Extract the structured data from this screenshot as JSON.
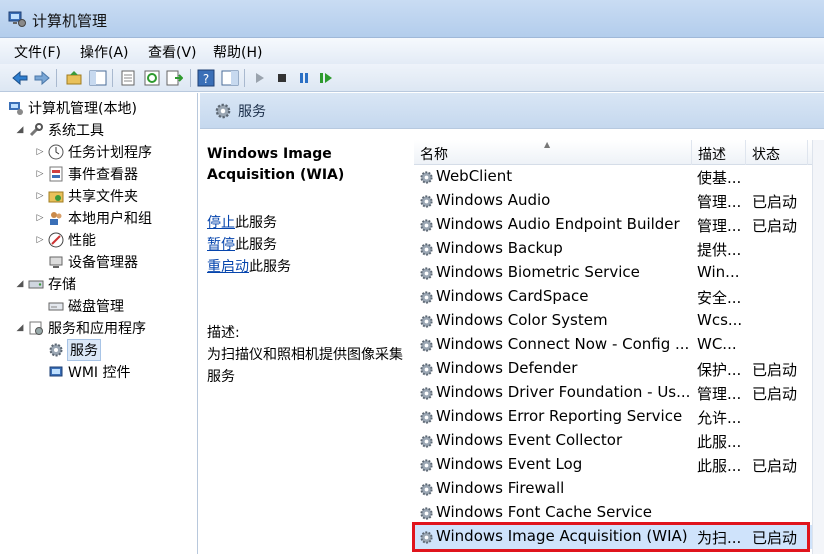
{
  "window": {
    "title": "计算机管理"
  },
  "menu": [
    "文件(F)",
    "操作(A)",
    "查看(V)",
    "帮助(H)"
  ],
  "tree": {
    "root": "计算机管理(本地)",
    "system_tools": "系统工具",
    "task_scheduler": "任务计划程序",
    "event_viewer": "事件查看器",
    "shared_folders": "共享文件夹",
    "local_users": "本地用户和组",
    "performance": "性能",
    "device_manager": "设备管理器",
    "storage": "存储",
    "disk_management": "磁盘管理",
    "services_apps": "服务和应用程序",
    "services": "服务",
    "wmi": "WMI 控件"
  },
  "header": {
    "title": "服务"
  },
  "detail": {
    "service_title": "Windows Image Acquisition (WIA)",
    "stop_link": "停止",
    "stop_suffix": "此服务",
    "pause_link": "暂停",
    "pause_suffix": "此服务",
    "restart_link": "重启动",
    "restart_suffix": "此服务",
    "desc_label": "描述:",
    "desc_text": "为扫描仪和照相机提供图像采集服务"
  },
  "columns": {
    "name": "名称",
    "desc": "描述",
    "status": "状态"
  },
  "services": [
    {
      "name": "WebClient",
      "desc": "使基...",
      "status": ""
    },
    {
      "name": "Windows Audio",
      "desc": "管理...",
      "status": "已启动"
    },
    {
      "name": "Windows Audio Endpoint Builder",
      "desc": "管理...",
      "status": "已启动"
    },
    {
      "name": "Windows Backup",
      "desc": "提供...",
      "status": ""
    },
    {
      "name": "Windows Biometric Service",
      "desc": "Win...",
      "status": ""
    },
    {
      "name": "Windows CardSpace",
      "desc": "安全...",
      "status": ""
    },
    {
      "name": "Windows Color System",
      "desc": "Wcs...",
      "status": ""
    },
    {
      "name": "Windows Connect Now - Config ...",
      "desc": "WC...",
      "status": ""
    },
    {
      "name": "Windows Defender",
      "desc": "保护...",
      "status": "已启动"
    },
    {
      "name": "Windows Driver Foundation - Us...",
      "desc": "管理...",
      "status": "已启动"
    },
    {
      "name": "Windows Error Reporting Service",
      "desc": "允许...",
      "status": ""
    },
    {
      "name": "Windows Event Collector",
      "desc": "此服...",
      "status": ""
    },
    {
      "name": "Windows Event Log",
      "desc": "此服...",
      "status": "已启动"
    },
    {
      "name": "Windows Firewall",
      "desc": "",
      "status": ""
    },
    {
      "name": "Windows Font Cache Service",
      "desc": "",
      "status": ""
    },
    {
      "name": "Windows Image Acquisition (WIA)",
      "desc": "为扫...",
      "status": "已启动"
    }
  ],
  "colors": {
    "highlight_border": "#e0141c",
    "link": "#0645ad",
    "selection": "#cfe3fb"
  }
}
